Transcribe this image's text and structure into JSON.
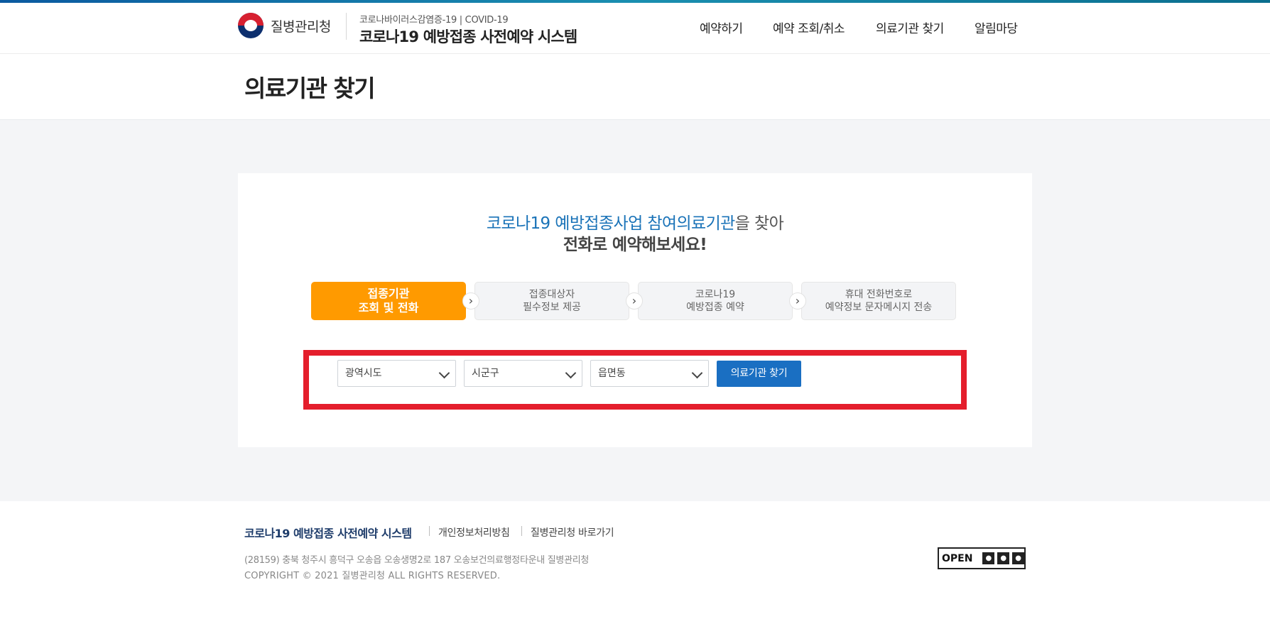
{
  "header": {
    "logo_text": "질병관리청",
    "system_subtitle": "코로나바이러스감염증-19 | COVID-19",
    "system_title": "코로나19 예방접종 사전예약 시스템",
    "nav": [
      "예약하기",
      "예약 조회/취소",
      "의료기관 찾기",
      "알림마당"
    ]
  },
  "page": {
    "title": "의료기관 찾기"
  },
  "intro": {
    "part1": "코로나19 예방접종사업 ",
    "part2": "참여의료기관",
    "part3": "을 찾아",
    "line2": "전화로 예약해보세요!"
  },
  "steps": [
    {
      "line1": "접종기관",
      "line2": "조회 및 전화"
    },
    {
      "line1": "접종대상자",
      "line2": "필수정보 제공"
    },
    {
      "line1": "코로나19",
      "line2": "예방접종 예약"
    },
    {
      "line1": "휴대 전화번호로",
      "line2": "예약정보 문자메시지 전송"
    }
  ],
  "search": {
    "region_select": "광역시도",
    "district_select": "시군구",
    "town_select": "읍면동",
    "button_label": "의료기관 찾기"
  },
  "footer": {
    "title": "코로나19 예방접종 사전예약 시스템",
    "privacy_link": "개인정보처리방침",
    "kdca_link": "질병관리청 바로가기",
    "address": "(28159) 충북 청주시 흥덕구 오송읍 오송생명2로 187 오송보건의료행정타운내 질병관리청",
    "copyright": "COPYRIGHT © 2021 질병관리청 ALL RIGHTS RESERVED.",
    "kogl_label": "OPEN"
  },
  "colors": {
    "accent": "#1a6fc2",
    "step_active": "#ff9a00",
    "highlight": "#e41e2c"
  }
}
